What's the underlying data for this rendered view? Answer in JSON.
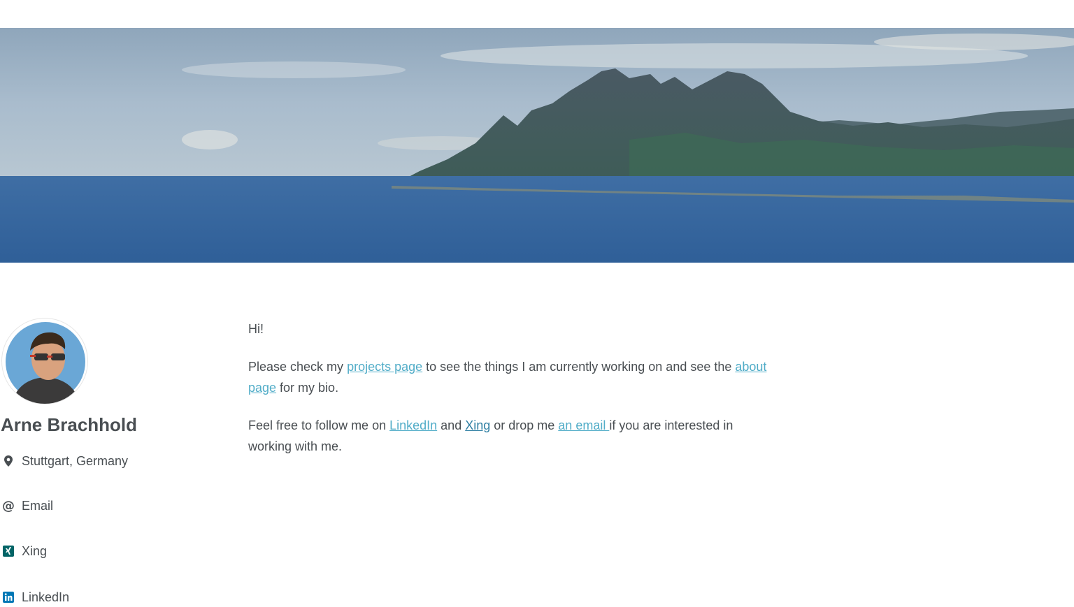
{
  "profile": {
    "name": "Arne Brachhold",
    "location": "Stuttgart, Germany",
    "links": {
      "email": "Email",
      "xing": "Xing",
      "linkedin": "LinkedIn"
    }
  },
  "content": {
    "greeting": "Hi!",
    "p1": {
      "before": "Please check my ",
      "projects_link": "projects page",
      "middle": " to see the things I am currently working on and see the ",
      "about_link": "about page",
      "after": " for my bio."
    },
    "p2": {
      "before": "Feel free to follow me on ",
      "linkedin_link": "LinkedIn",
      "and": " and ",
      "xing_link": "Xing",
      "middle": " or drop me ",
      "email_link": "an email ",
      "after": "if you are interested in working with me."
    }
  },
  "icons": {
    "location": "map-marker-icon",
    "email": "at-sign-icon",
    "xing": "xing-icon",
    "linkedin": "linkedin-icon"
  },
  "colors": {
    "link": "#52adc8",
    "text": "#494e52",
    "xing": "#026466",
    "linkedin": "#0077b5"
  }
}
